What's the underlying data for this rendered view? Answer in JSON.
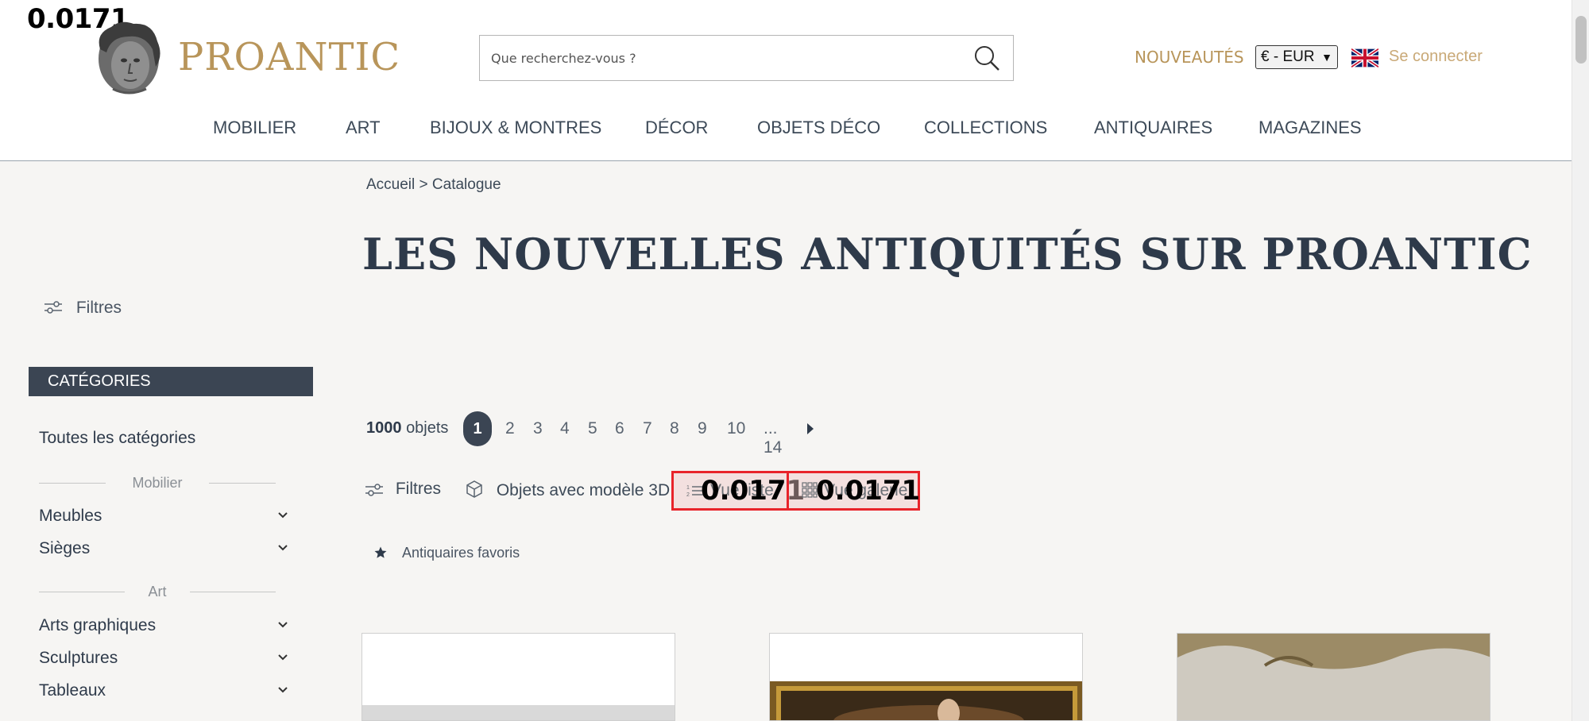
{
  "overlay": {
    "value": "0.0171"
  },
  "header": {
    "logo_text": "PROANTIC",
    "search_placeholder": "Que recherchez-vous ?",
    "nouveautes": "NOUVEAUTÉS",
    "currency": "€ - EUR",
    "connect": "Se connecter",
    "nav": [
      "MOBILIER",
      "ART",
      "BIJOUX & MONTRES",
      "DÉCOR",
      "OBJETS DÉCO",
      "COLLECTIONS",
      "ANTIQUAIRES",
      "MAGAZINES"
    ]
  },
  "breadcrumb": {
    "home": "Accueil",
    "separator": ">",
    "current": "Catalogue"
  },
  "page_title": "LES NOUVELLES ANTIQUITÉS SUR PROANTIC",
  "sidebar": {
    "filters": "Filtres",
    "categories_header": "CATÉGORIES",
    "all_categories": "Toutes les catégories",
    "group_mobilier": "Mobilier",
    "item_meubles": "Meubles",
    "item_sieges": "Sièges",
    "group_art": "Art",
    "item_arts_graphiques": "Arts graphiques",
    "item_sculptures": "Sculptures",
    "item_tableaux": "Tableaux"
  },
  "results": {
    "count": "1000",
    "count_suffix": "objets",
    "pages": [
      "1",
      "2",
      "3",
      "4",
      "5",
      "6",
      "7",
      "8",
      "9",
      "10"
    ],
    "last_page": "... 14"
  },
  "toolbar": {
    "filters": "Filtres",
    "models_3d": "Objets avec modèle 3D",
    "view_list": "Vue liste",
    "view_list_value": "0.0171",
    "view_gallery": "Vue galerie",
    "view_gallery_value": "0.0171",
    "favorites": "Antiquaires favoris"
  },
  "colors": {
    "accent_gold": "#b8955a",
    "navy": "#3b4553",
    "highlight_red": "#e8232a"
  }
}
